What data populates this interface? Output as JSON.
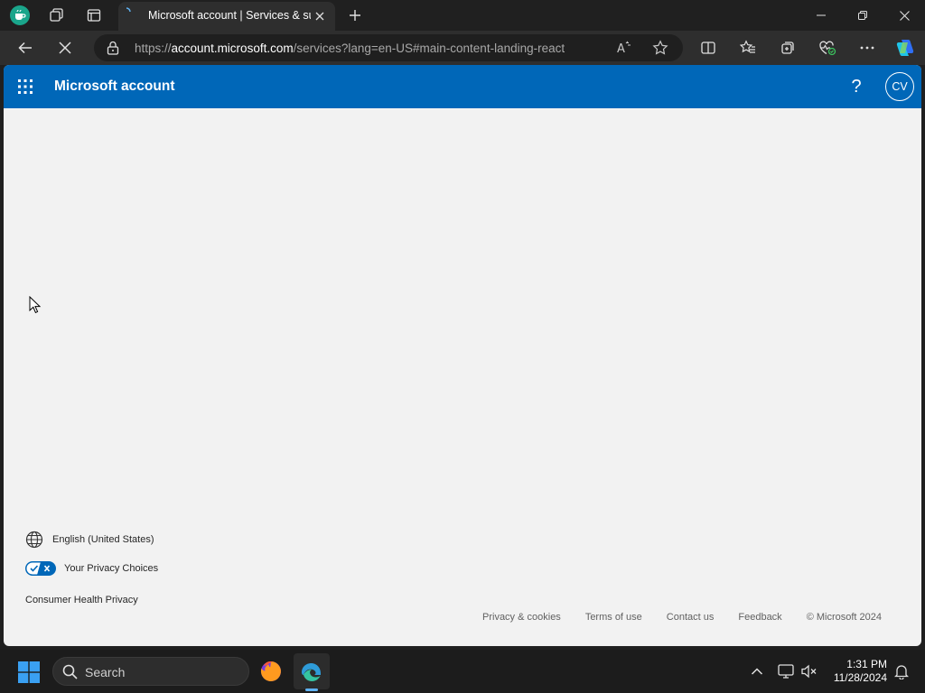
{
  "browser": {
    "tab_title": "Microsoft account | Services & subscriptions",
    "url_prefix": "https://",
    "url_host": "account.microsoft.com",
    "url_path": "/services?lang=en-US#main-content-landing-react"
  },
  "page": {
    "header_title": "Microsoft account",
    "help_label": "?",
    "avatar_initials": "CV",
    "language_label": "English (United States)",
    "privacy_choices_label": "Your Privacy Choices",
    "health_privacy_label": "Consumer Health Privacy",
    "footer_links": [
      "Privacy & cookies",
      "Terms of use",
      "Contact us",
      "Feedback"
    ],
    "copyright": "© Microsoft 2024"
  },
  "taskbar": {
    "search_label": "Search",
    "time": "1:31 PM",
    "date": "11/28/2024"
  },
  "colors": {
    "header_blue": "#0067b8",
    "page_bg": "#f2f2f2",
    "privacy_toggle": "#0067b8"
  }
}
